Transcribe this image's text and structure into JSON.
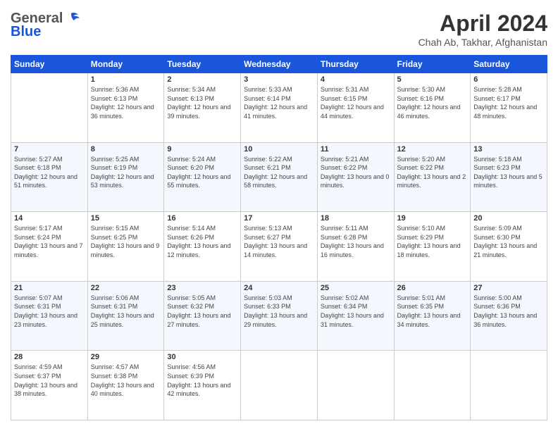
{
  "logo": {
    "general": "General",
    "blue": "Blue"
  },
  "header": {
    "title": "April 2024",
    "subtitle": "Chah Ab, Takhar, Afghanistan"
  },
  "weekdays": [
    "Sunday",
    "Monday",
    "Tuesday",
    "Wednesday",
    "Thursday",
    "Friday",
    "Saturday"
  ],
  "weeks": [
    [
      {
        "day": "",
        "sunrise": "",
        "sunset": "",
        "daylight": ""
      },
      {
        "day": "1",
        "sunrise": "Sunrise: 5:36 AM",
        "sunset": "Sunset: 6:13 PM",
        "daylight": "Daylight: 12 hours and 36 minutes."
      },
      {
        "day": "2",
        "sunrise": "Sunrise: 5:34 AM",
        "sunset": "Sunset: 6:13 PM",
        "daylight": "Daylight: 12 hours and 39 minutes."
      },
      {
        "day": "3",
        "sunrise": "Sunrise: 5:33 AM",
        "sunset": "Sunset: 6:14 PM",
        "daylight": "Daylight: 12 hours and 41 minutes."
      },
      {
        "day": "4",
        "sunrise": "Sunrise: 5:31 AM",
        "sunset": "Sunset: 6:15 PM",
        "daylight": "Daylight: 12 hours and 44 minutes."
      },
      {
        "day": "5",
        "sunrise": "Sunrise: 5:30 AM",
        "sunset": "Sunset: 6:16 PM",
        "daylight": "Daylight: 12 hours and 46 minutes."
      },
      {
        "day": "6",
        "sunrise": "Sunrise: 5:28 AM",
        "sunset": "Sunset: 6:17 PM",
        "daylight": "Daylight: 12 hours and 48 minutes."
      }
    ],
    [
      {
        "day": "7",
        "sunrise": "Sunrise: 5:27 AM",
        "sunset": "Sunset: 6:18 PM",
        "daylight": "Daylight: 12 hours and 51 minutes."
      },
      {
        "day": "8",
        "sunrise": "Sunrise: 5:25 AM",
        "sunset": "Sunset: 6:19 PM",
        "daylight": "Daylight: 12 hours and 53 minutes."
      },
      {
        "day": "9",
        "sunrise": "Sunrise: 5:24 AM",
        "sunset": "Sunset: 6:20 PM",
        "daylight": "Daylight: 12 hours and 55 minutes."
      },
      {
        "day": "10",
        "sunrise": "Sunrise: 5:22 AM",
        "sunset": "Sunset: 6:21 PM",
        "daylight": "Daylight: 12 hours and 58 minutes."
      },
      {
        "day": "11",
        "sunrise": "Sunrise: 5:21 AM",
        "sunset": "Sunset: 6:22 PM",
        "daylight": "Daylight: 13 hours and 0 minutes."
      },
      {
        "day": "12",
        "sunrise": "Sunrise: 5:20 AM",
        "sunset": "Sunset: 6:22 PM",
        "daylight": "Daylight: 13 hours and 2 minutes."
      },
      {
        "day": "13",
        "sunrise": "Sunrise: 5:18 AM",
        "sunset": "Sunset: 6:23 PM",
        "daylight": "Daylight: 13 hours and 5 minutes."
      }
    ],
    [
      {
        "day": "14",
        "sunrise": "Sunrise: 5:17 AM",
        "sunset": "Sunset: 6:24 PM",
        "daylight": "Daylight: 13 hours and 7 minutes."
      },
      {
        "day": "15",
        "sunrise": "Sunrise: 5:15 AM",
        "sunset": "Sunset: 6:25 PM",
        "daylight": "Daylight: 13 hours and 9 minutes."
      },
      {
        "day": "16",
        "sunrise": "Sunrise: 5:14 AM",
        "sunset": "Sunset: 6:26 PM",
        "daylight": "Daylight: 13 hours and 12 minutes."
      },
      {
        "day": "17",
        "sunrise": "Sunrise: 5:13 AM",
        "sunset": "Sunset: 6:27 PM",
        "daylight": "Daylight: 13 hours and 14 minutes."
      },
      {
        "day": "18",
        "sunrise": "Sunrise: 5:11 AM",
        "sunset": "Sunset: 6:28 PM",
        "daylight": "Daylight: 13 hours and 16 minutes."
      },
      {
        "day": "19",
        "sunrise": "Sunrise: 5:10 AM",
        "sunset": "Sunset: 6:29 PM",
        "daylight": "Daylight: 13 hours and 18 minutes."
      },
      {
        "day": "20",
        "sunrise": "Sunrise: 5:09 AM",
        "sunset": "Sunset: 6:30 PM",
        "daylight": "Daylight: 13 hours and 21 minutes."
      }
    ],
    [
      {
        "day": "21",
        "sunrise": "Sunrise: 5:07 AM",
        "sunset": "Sunset: 6:31 PM",
        "daylight": "Daylight: 13 hours and 23 minutes."
      },
      {
        "day": "22",
        "sunrise": "Sunrise: 5:06 AM",
        "sunset": "Sunset: 6:31 PM",
        "daylight": "Daylight: 13 hours and 25 minutes."
      },
      {
        "day": "23",
        "sunrise": "Sunrise: 5:05 AM",
        "sunset": "Sunset: 6:32 PM",
        "daylight": "Daylight: 13 hours and 27 minutes."
      },
      {
        "day": "24",
        "sunrise": "Sunrise: 5:03 AM",
        "sunset": "Sunset: 6:33 PM",
        "daylight": "Daylight: 13 hours and 29 minutes."
      },
      {
        "day": "25",
        "sunrise": "Sunrise: 5:02 AM",
        "sunset": "Sunset: 6:34 PM",
        "daylight": "Daylight: 13 hours and 31 minutes."
      },
      {
        "day": "26",
        "sunrise": "Sunrise: 5:01 AM",
        "sunset": "Sunset: 6:35 PM",
        "daylight": "Daylight: 13 hours and 34 minutes."
      },
      {
        "day": "27",
        "sunrise": "Sunrise: 5:00 AM",
        "sunset": "Sunset: 6:36 PM",
        "daylight": "Daylight: 13 hours and 36 minutes."
      }
    ],
    [
      {
        "day": "28",
        "sunrise": "Sunrise: 4:59 AM",
        "sunset": "Sunset: 6:37 PM",
        "daylight": "Daylight: 13 hours and 38 minutes."
      },
      {
        "day": "29",
        "sunrise": "Sunrise: 4:57 AM",
        "sunset": "Sunset: 6:38 PM",
        "daylight": "Daylight: 13 hours and 40 minutes."
      },
      {
        "day": "30",
        "sunrise": "Sunrise: 4:56 AM",
        "sunset": "Sunset: 6:39 PM",
        "daylight": "Daylight: 13 hours and 42 minutes."
      },
      {
        "day": "",
        "sunrise": "",
        "sunset": "",
        "daylight": ""
      },
      {
        "day": "",
        "sunrise": "",
        "sunset": "",
        "daylight": ""
      },
      {
        "day": "",
        "sunrise": "",
        "sunset": "",
        "daylight": ""
      },
      {
        "day": "",
        "sunrise": "",
        "sunset": "",
        "daylight": ""
      }
    ]
  ]
}
